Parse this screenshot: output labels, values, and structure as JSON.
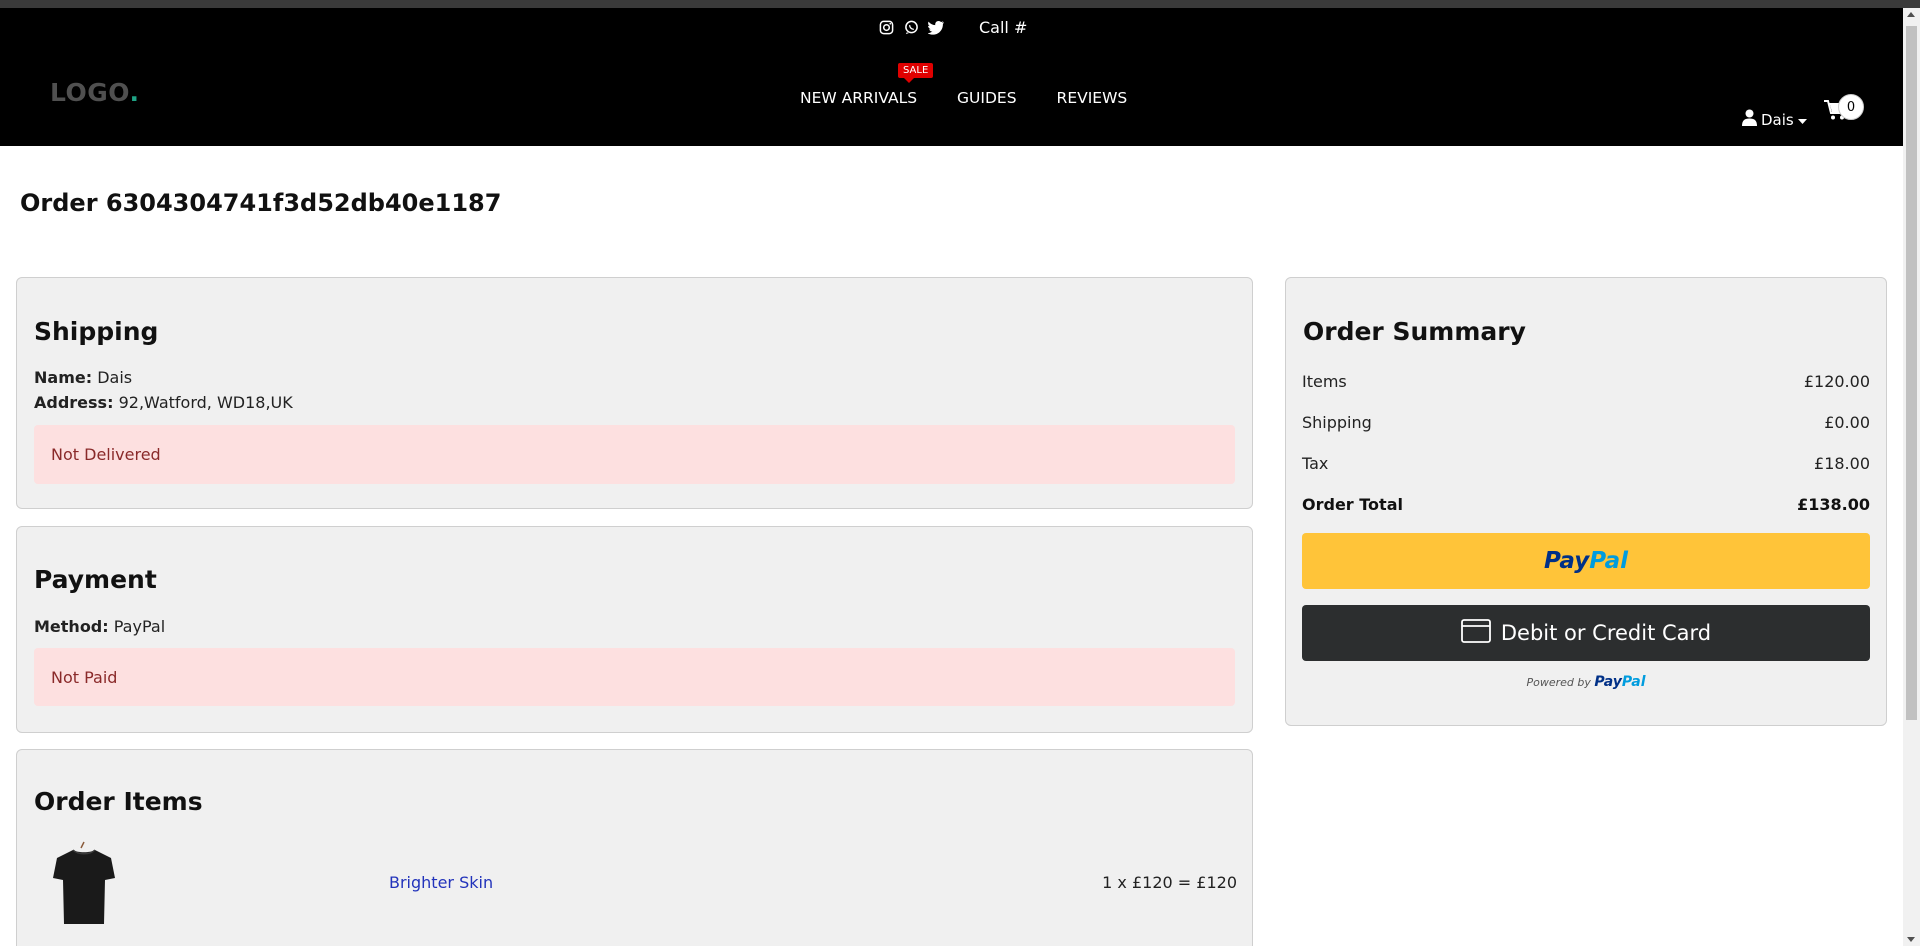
{
  "header": {
    "call_text": "Call #",
    "logo_text": "LOGO",
    "logo_dot": ".",
    "nav": [
      {
        "label": "NEW ARRIVALS",
        "badge": "SALE"
      },
      {
        "label": "GUIDES"
      },
      {
        "label": "REVIEWS"
      }
    ],
    "user_name": "Dais",
    "cart_count": "0",
    "icons": [
      "instagram-icon",
      "whatsapp-icon",
      "twitter-icon",
      "user-icon",
      "caret-down-icon",
      "cart-icon"
    ]
  },
  "order": {
    "title": "Order 6304304741f3d52db40e1187"
  },
  "shipping": {
    "heading": "Shipping",
    "name_label": "Name:",
    "name_value": "Dais",
    "address_label": "Address:",
    "address_value": "92,Watford, WD18,UK",
    "status": "Not Delivered"
  },
  "payment": {
    "heading": "Payment",
    "method_label": "Method:",
    "method_value": "PayPal",
    "status": "Not Paid"
  },
  "order_items": {
    "heading": "Order Items",
    "items": [
      {
        "name": "Brighter Skin",
        "line": "1 x £120 = £120",
        "image": "black-tshirt"
      }
    ]
  },
  "summary": {
    "heading": "Order Summary",
    "rows": [
      {
        "label": "Items",
        "value": "£120.00"
      },
      {
        "label": "Shipping",
        "value": "£0.00"
      },
      {
        "label": "Tax",
        "value": "£18.00"
      },
      {
        "label": "Order Total",
        "value": "£138.00"
      }
    ],
    "paypal_pay": "Pay",
    "paypal_pal": "Pal",
    "card_button": "Debit or Credit Card",
    "powered_by": "Powered by",
    "powered_pay": "Pay",
    "powered_pal": "Pal"
  },
  "colors": {
    "navbar": "#000000",
    "logo_dot": "#1fa385",
    "sale_badge": "#e00000",
    "alert_bg": "#fde0e0",
    "alert_text": "#8a2a2a",
    "paypal_yellow": "#ffc439",
    "card_dark": "#2c2e2f",
    "link": "#2233bb"
  }
}
